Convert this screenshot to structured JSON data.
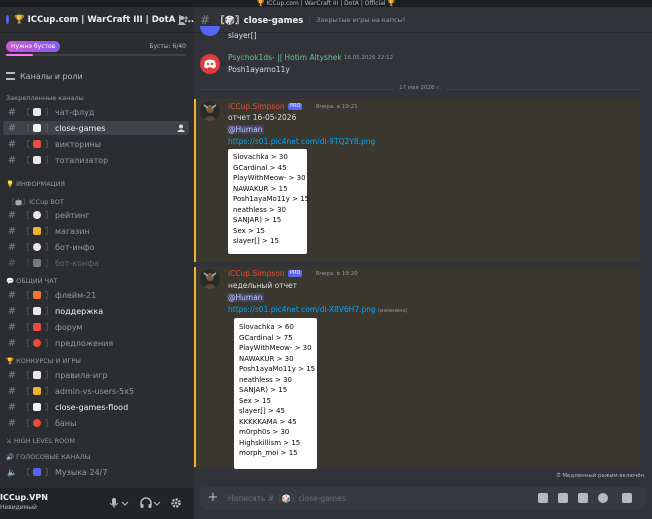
{
  "window": {
    "title": "🏆 ICCup.com | WarCraft III | DotA | Official 🏆"
  },
  "server": {
    "name": "🏆 ICCup.com | WarCraft III | DotA | ...",
    "boost_label": "Нужно бустов",
    "boost_count": "Бусты: 6/40",
    "boost_progress": 0.15,
    "roles_label": "Каналы и роли"
  },
  "categories": {
    "pinned": "Закрепленные каналы",
    "info": "💡 ИНФОРМАЦИЯ",
    "bot": "〖🤖〗ICCup BOT",
    "chat": "💬 ОБЩИЙ ЧАТ",
    "contests": "🏆 КОНКУРСЫ И ИГРЫ",
    "high": "⚔ HIGH LEVEL ROOM",
    "voice": "🔊 ГОЛОСОВЫЕ КАНАЛЫ"
  },
  "channels": [
    {
      "label": "чат-флуд"
    },
    {
      "label": "close-games"
    },
    {
      "label": "викторины"
    },
    {
      "label": "тотализатор"
    },
    {
      "label": "рейтинг"
    },
    {
      "label": "магазин"
    },
    {
      "label": "бот-инфо"
    },
    {
      "label": "бот-конфа"
    },
    {
      "label": "флейм-21"
    },
    {
      "label": "поддержка"
    },
    {
      "label": "форум"
    },
    {
      "label": "предложения"
    },
    {
      "label": "правила-игр"
    },
    {
      "label": "admin-vs-users-5x5"
    },
    {
      "label": "close-games-flood"
    },
    {
      "label": "баны"
    },
    {
      "label": "Музыка 24/7"
    }
  ],
  "user": {
    "name": "ICCup.VPN",
    "status": "Невидимый"
  },
  "header": {
    "channel": "〖🎲〗close-games",
    "topic": "Закрытые игры на капсы!"
  },
  "messages": {
    "top_partial": "slayer[]",
    "m1": {
      "author": "Psychok1ds- || Hotim Altyshek",
      "time": "16.05.2026 22:12",
      "text": "Posh1ayamo11y"
    },
    "date_divider": "17 мая 2026 г.",
    "m2": {
      "author": "iCCup.Simpson",
      "badge": "PRO",
      "time": "Вчера, в 19:21",
      "text": "отчет 16-05-2026",
      "mention": "@Human",
      "link": "https://s01.pic4net.com/di-9TQ2Y8.png",
      "list": [
        "Slovachka > 30",
        "GCardinal > 45",
        "PlayWithMeow- > 30",
        "NAWAKUR > 15",
        "Posh1ayaMo11y > 15",
        "neathless > 30",
        "SANJAR) > 15",
        "Sex > 15",
        "slayer[] > 15"
      ]
    },
    "m3": {
      "author": "iCCup.Simpson",
      "badge": "PRO",
      "time": "Вчера, в 19:20",
      "text": "недельный отчет",
      "mention": "@Human",
      "link": "https://s01.pic4net.com/di-X8V6H7.png",
      "link_edited": "(изменено)",
      "list": [
        "Slovachka > 60",
        "GCardinal > 75",
        "PlayWithMeow- > 30",
        "NAWAKUR > 30",
        "Posh1ayaMo11y > 15",
        "neathless > 30",
        "SANJAR) > 15",
        "Sex > 15",
        "slayer[] > 45",
        "KKKKKAMA > 45",
        "m0rph0s > 30",
        "Highskillism > 15",
        "morph_moi > 15"
      ]
    }
  },
  "slowmode": "Медленный режим включён.",
  "composer": {
    "placeholder": "Написать #〖🎲〗close-games"
  }
}
